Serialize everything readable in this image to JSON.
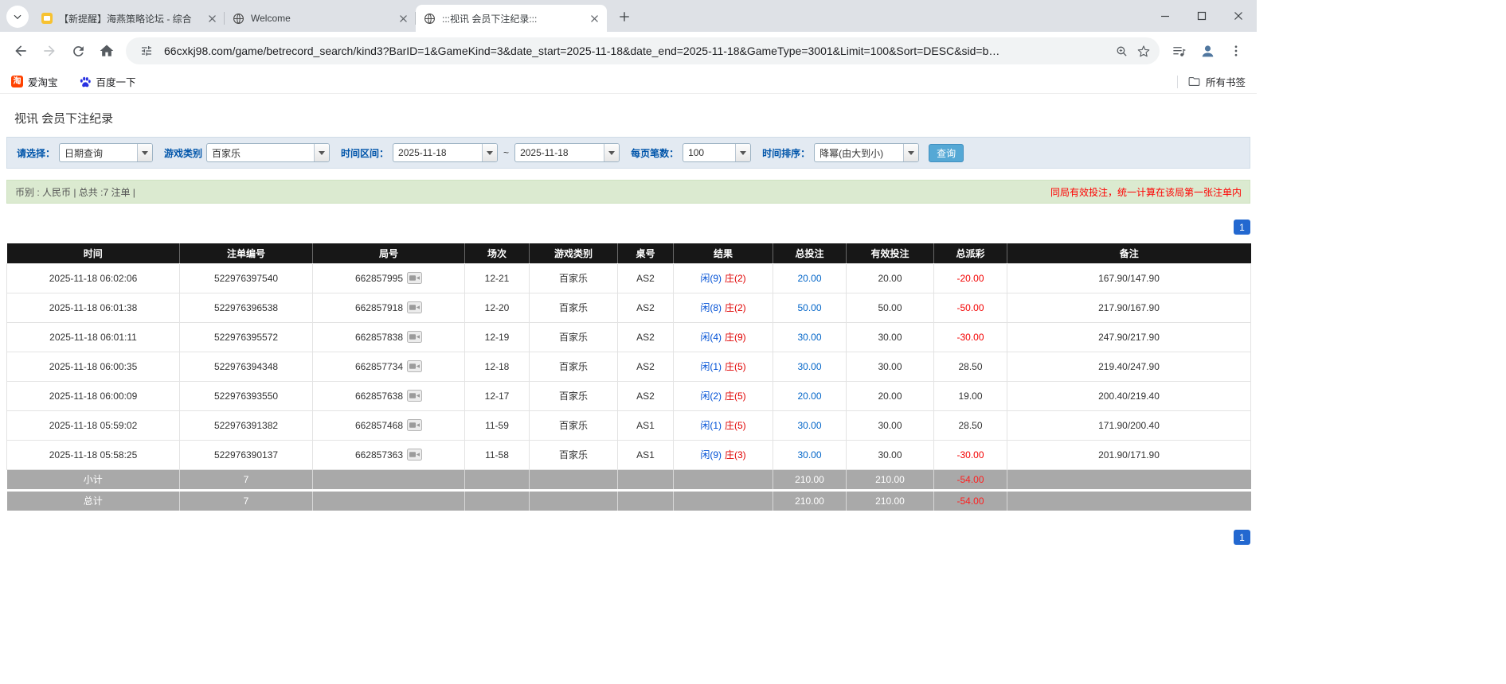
{
  "colors": {
    "accent_blue": "#2368d0",
    "link_blue": "#0064c8",
    "player_blue": "#0050d5",
    "banker_red": "#e00000",
    "negative_red": "#f30000",
    "table_header_bg": "#171717",
    "table_footer_bg": "#a9a9a9",
    "filter_bar_bg": "#e3eaf2",
    "filter_label_blue": "#0055aa",
    "summary_bar_bg": "#dbead0",
    "query_button_bg": "#55a8d5"
  },
  "browser": {
    "tabs": [
      {
        "title": "【新提醒】海燕策略论坛 - 综合",
        "icon": "mail-icon",
        "active": false
      },
      {
        "title": "Welcome",
        "icon": "globe-icon",
        "active": false
      },
      {
        "title": ":::视讯 会员下注纪录:::",
        "icon": "globe-icon",
        "active": true
      }
    ],
    "url": "66cxkj98.com/game/betrecord_search/kind3?BarID=1&GameKind=3&date_start=2025-11-18&date_end=2025-11-18&GameType=3001&Limit=100&Sort=DESC&sid=b…",
    "bookmarks": [
      {
        "label": "爱淘宝",
        "icon": "taobao-icon",
        "glyph": "淘"
      },
      {
        "label": "百度一下",
        "icon": "baidu-icon",
        "glyph": ""
      }
    ],
    "all_bookmarks_label": "所有书签"
  },
  "page": {
    "title": "视讯 会员下注纪录",
    "filters": {
      "select_label": "请选择：",
      "select_value": "日期查询",
      "game_label": "游戏类别",
      "game_value": "百家乐",
      "range_label": "时间区间：",
      "date_start": "2025-11-18",
      "tilde": "~",
      "date_end": "2025-11-18",
      "page_size_label": "每页笔数：",
      "page_size_value": "100",
      "sort_label": "时间排序：",
      "sort_value": "降幂(由大到小)",
      "query_button": "查询"
    },
    "summary_left": "币别 : 人民币 | 总共 :7 注单 |",
    "summary_right": "同局有效投注，统一计算在该局第一张注单内",
    "pagination_label": "1",
    "table": {
      "headers": [
        "时间",
        "注单编号",
        "局号",
        "场次",
        "游戏类别",
        "桌号",
        "结果",
        "总投注",
        "有效投注",
        "总派彩",
        "备注"
      ],
      "rows": [
        {
          "time": "2025-11-18 06:02:06",
          "bet_id": "522976397540",
          "round": "662857995",
          "session": "12-21",
          "game": "百家乐",
          "table_no": "AS2",
          "result_player": "闲(9)",
          "result_banker": "庄(2)",
          "total_bet": "20.00",
          "valid_bet": "20.00",
          "payout": "-20.00",
          "remark": "167.90/147.90"
        },
        {
          "time": "2025-11-18 06:01:38",
          "bet_id": "522976396538",
          "round": "662857918",
          "session": "12-20",
          "game": "百家乐",
          "table_no": "AS2",
          "result_player": "闲(8)",
          "result_banker": "庄(2)",
          "total_bet": "50.00",
          "valid_bet": "50.00",
          "payout": "-50.00",
          "remark": "217.90/167.90"
        },
        {
          "time": "2025-11-18 06:01:11",
          "bet_id": "522976395572",
          "round": "662857838",
          "session": "12-19",
          "game": "百家乐",
          "table_no": "AS2",
          "result_player": "闲(4)",
          "result_banker": "庄(9)",
          "total_bet": "30.00",
          "valid_bet": "30.00",
          "payout": "-30.00",
          "remark": "247.90/217.90"
        },
        {
          "time": "2025-11-18 06:00:35",
          "bet_id": "522976394348",
          "round": "662857734",
          "session": "12-18",
          "game": "百家乐",
          "table_no": "AS2",
          "result_player": "闲(1)",
          "result_banker": "庄(5)",
          "total_bet": "30.00",
          "valid_bet": "30.00",
          "payout": "28.50",
          "remark": "219.40/247.90"
        },
        {
          "time": "2025-11-18 06:00:09",
          "bet_id": "522976393550",
          "round": "662857638",
          "session": "12-17",
          "game": "百家乐",
          "table_no": "AS2",
          "result_player": "闲(2)",
          "result_banker": "庄(5)",
          "total_bet": "20.00",
          "valid_bet": "20.00",
          "payout": "19.00",
          "remark": "200.40/219.40"
        },
        {
          "time": "2025-11-18 05:59:02",
          "bet_id": "522976391382",
          "round": "662857468",
          "session": "11-59",
          "game": "百家乐",
          "table_no": "AS1",
          "result_player": "闲(1)",
          "result_banker": "庄(5)",
          "total_bet": "30.00",
          "valid_bet": "30.00",
          "payout": "28.50",
          "remark": "171.90/200.40"
        },
        {
          "time": "2025-11-18 05:58:25",
          "bet_id": "522976390137",
          "round": "662857363",
          "session": "11-58",
          "game": "百家乐",
          "table_no": "AS1",
          "result_player": "闲(9)",
          "result_banker": "庄(3)",
          "total_bet": "30.00",
          "valid_bet": "30.00",
          "payout": "-30.00",
          "remark": "201.90/171.90"
        }
      ],
      "footer_rows": [
        {
          "label": "小计",
          "count": "7",
          "total_bet": "210.00",
          "valid_bet": "210.00",
          "payout": "-54.00"
        },
        {
          "label": "总计",
          "count": "7",
          "total_bet": "210.00",
          "valid_bet": "210.00",
          "payout": "-54.00"
        }
      ]
    }
  }
}
